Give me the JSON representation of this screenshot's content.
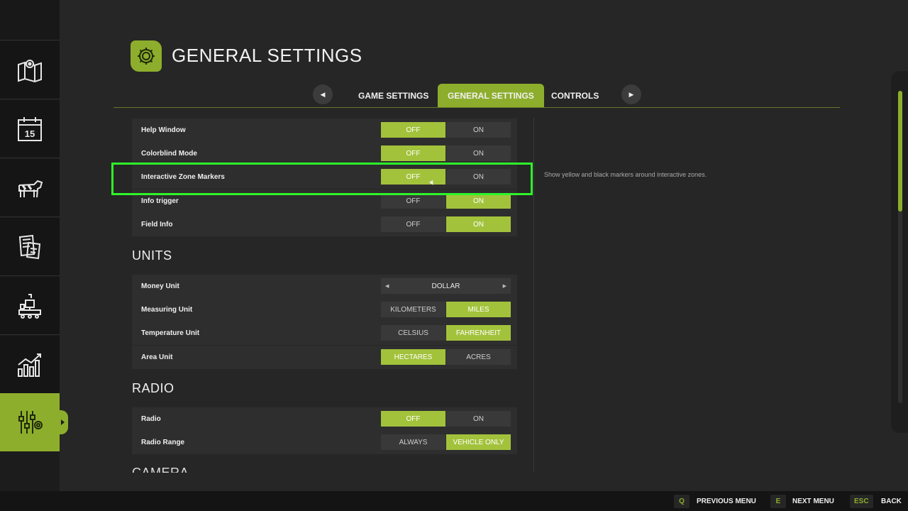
{
  "header": {
    "title": "GENERAL SETTINGS"
  },
  "tabs": [
    {
      "label": "GAME SETTINGS",
      "active": false
    },
    {
      "label": "GENERAL SETTINGS",
      "active": true
    },
    {
      "label": "CONTROLS",
      "active": false
    }
  ],
  "sidebar": {
    "items": [
      {
        "icon": "map-icon"
      },
      {
        "icon": "calendar-icon",
        "date": "15"
      },
      {
        "icon": "cow-icon"
      },
      {
        "icon": "contracts-icon"
      },
      {
        "icon": "production-icon"
      },
      {
        "icon": "statistics-icon"
      },
      {
        "icon": "settings-sliders-icon",
        "active": true
      }
    ]
  },
  "settings": {
    "rows": [
      {
        "label": "Help Window",
        "options": [
          "OFF",
          "ON"
        ],
        "selected": 0
      },
      {
        "label": "Colorblind Mode",
        "options": [
          "OFF",
          "ON"
        ],
        "selected": 0
      },
      {
        "label": "Interactive Zone Markers",
        "options": [
          "OFF",
          "ON"
        ],
        "selected": 0,
        "highlighted": true
      },
      {
        "label": "Info trigger",
        "options": [
          "OFF",
          "ON"
        ],
        "selected": 1
      },
      {
        "label": "Field Info",
        "options": [
          "OFF",
          "ON"
        ],
        "selected": 1
      }
    ],
    "units_title": "UNITS",
    "units": {
      "money": {
        "label": "Money Unit",
        "value": "DOLLAR"
      },
      "rows": [
        {
          "label": "Measuring Unit",
          "options": [
            "KILOMETERS",
            "MILES"
          ],
          "selected": 1
        },
        {
          "label": "Temperature Unit",
          "options": [
            "CELSIUS",
            "FAHRENHEIT"
          ],
          "selected": 1
        },
        {
          "label": "Area Unit",
          "options": [
            "HECTARES",
            "ACRES"
          ],
          "selected": 0
        }
      ]
    },
    "radio_title": "RADIO",
    "radio": [
      {
        "label": "Radio",
        "options": [
          "OFF",
          "ON"
        ],
        "selected": 0
      },
      {
        "label": "Radio Range",
        "options": [
          "ALWAYS",
          "VEHICLE ONLY"
        ],
        "selected": 1
      }
    ],
    "camera_title": "CAMERA"
  },
  "description": "Show yellow and black markers around interactive zones.",
  "bottom_bar": {
    "prev": {
      "key": "Q",
      "label": "PREVIOUS MENU"
    },
    "next": {
      "key": "E",
      "label": "NEXT MENU"
    },
    "back": {
      "key": "ESC",
      "label": "BACK"
    }
  },
  "colors": {
    "accent": "#8dae2c",
    "selected": "#a3c23c",
    "highlight": "#2ef52a",
    "background": "#262626"
  }
}
